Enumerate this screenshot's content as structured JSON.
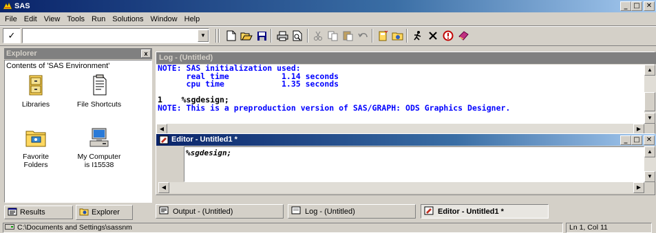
{
  "app": {
    "title": "SAS"
  },
  "menu": [
    "File",
    "Edit",
    "View",
    "Tools",
    "Run",
    "Solutions",
    "Window",
    "Help"
  ],
  "toolbar": {
    "check_glyph": "✓",
    "command_value": "",
    "icons": [
      "new-icon",
      "open-icon",
      "save-icon",
      "print-icon",
      "print-preview-icon",
      "cut-icon",
      "copy-icon",
      "paste-icon",
      "undo-icon",
      "new-library-icon",
      "explorer-icon",
      "run-icon",
      "clear-icon",
      "help-icon",
      "book-icon"
    ]
  },
  "explorer": {
    "title": "Explorer",
    "heading": "Contents of 'SAS Environment'",
    "items": [
      {
        "label_1": "Libraries",
        "label_2": "",
        "icon": "cabinet-icon"
      },
      {
        "label_1": "File Shortcuts",
        "label_2": "",
        "icon": "shortcut-icon"
      },
      {
        "label_1": "Favorite",
        "label_2": "Folders",
        "icon": "favorite-folder-icon"
      },
      {
        "label_1": "My Computer",
        "label_2": "is I15538",
        "icon": "my-computer-icon"
      }
    ],
    "tabs": {
      "results": "Results",
      "explorer": "Explorer"
    }
  },
  "log": {
    "title": "Log - (Untitled)",
    "lines": [
      "NOTE: SAS initialization used:",
      "      real time           1.14 seconds",
      "      cpu time            1.35 seconds",
      "",
      "1    %sgdesign;",
      "NOTE: This is a preproduction version of SAS/GRAPH: ODS Graphics Designer."
    ]
  },
  "editor": {
    "title": "Editor - Untitled1 *",
    "code": "%sgdesign;"
  },
  "windowbar": {
    "tabs": [
      "Output - (Untitled)",
      "Log - (Untitled)",
      "Editor - Untitled1 *"
    ],
    "active_index": 2
  },
  "status": {
    "path": "C:\\Documents and Settings\\sassnm",
    "position": "Ln 1, Col 11"
  }
}
